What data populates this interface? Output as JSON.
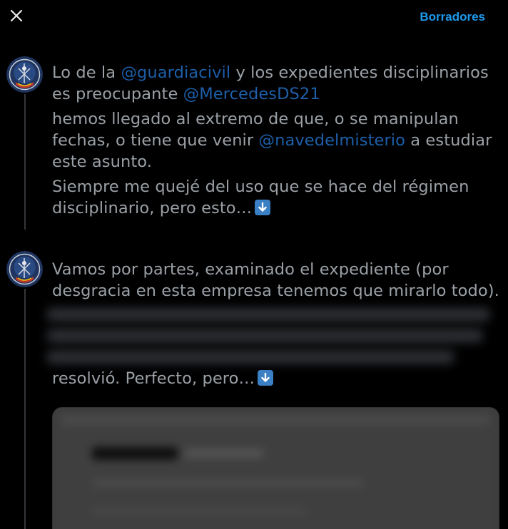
{
  "header": {
    "close_icon": "close-icon",
    "drafts_label": "Borradores",
    "accent_color": "#1d9bf0"
  },
  "tweet1": {
    "p1_pre": "Lo de la ",
    "p1_mention1": "@guardiacivil",
    "p1_mid": " y los expedientes disciplinarios es preocupante ",
    "p1_mention2": "@MercedesDS21",
    "p2_pre": "hemos llegado al extremo de que, o se manipulan fechas, o tiene que venir ",
    "p2_mention": "@navedelmisterio",
    "p2_post": " a estudiar este asunto.",
    "p3": "Siempre me quejé del uso que se hace del régimen disciplinario, pero esto…",
    "emoji": "down-arrow-emoji"
  },
  "tweet2": {
    "p1": "Vamos por partes, examinado el expediente (por desgracia en esta empresa tenemos que mirarlo todo).",
    "p_end": "resolvió. Perfecto, pero…",
    "emoji": "down-arrow-emoji"
  }
}
